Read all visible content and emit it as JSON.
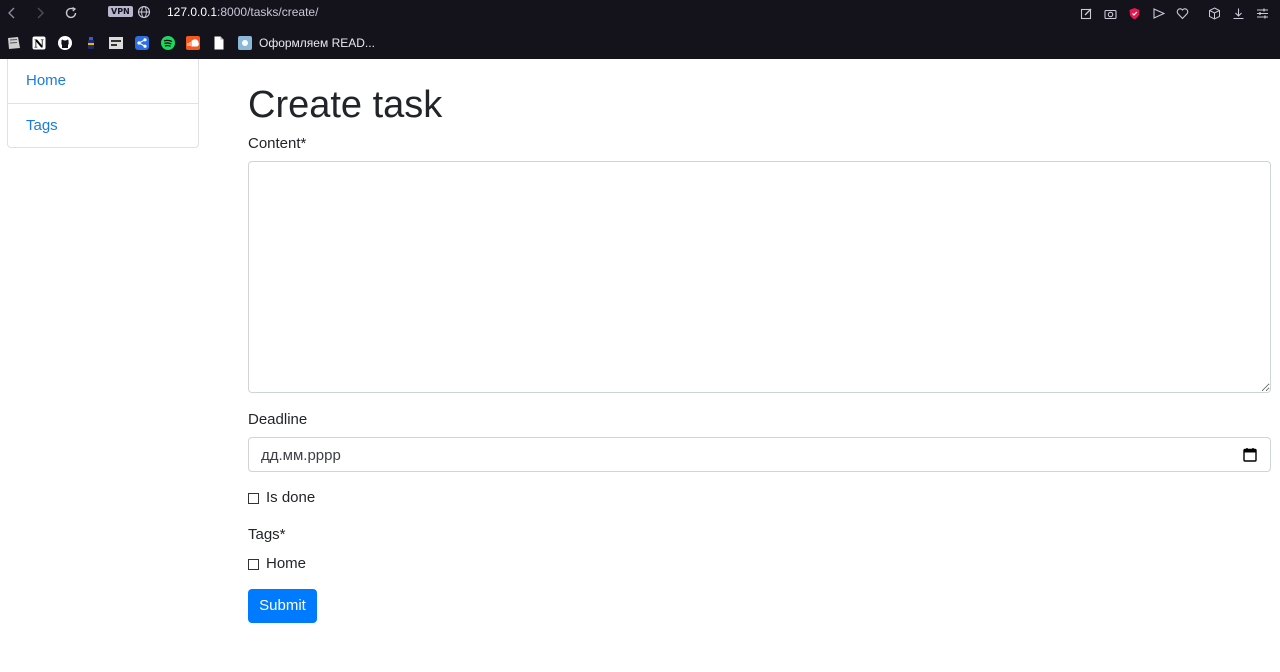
{
  "browser": {
    "vpn_badge": "VPN",
    "url_host": "127.0.0.1",
    "url_rest": ":8000/tasks/create/",
    "bookmark_label": "Оформляем READ..."
  },
  "sidebar": {
    "items": [
      {
        "label": "Home"
      },
      {
        "label": "Tags"
      }
    ]
  },
  "form": {
    "title": "Create task",
    "content_label": "Content*",
    "content_value": "",
    "deadline_label": "Deadline",
    "deadline_placeholder": "дд.мм.рррр",
    "is_done_label": "Is done",
    "is_done_checked": false,
    "tags_label": "Tags*",
    "tag_options": [
      {
        "label": "Home",
        "checked": false
      }
    ],
    "submit_label": "Submit"
  },
  "colors": {
    "chrome_bg": "#14131c",
    "link": "#1a7be0",
    "primary_button": "#007bff"
  }
}
